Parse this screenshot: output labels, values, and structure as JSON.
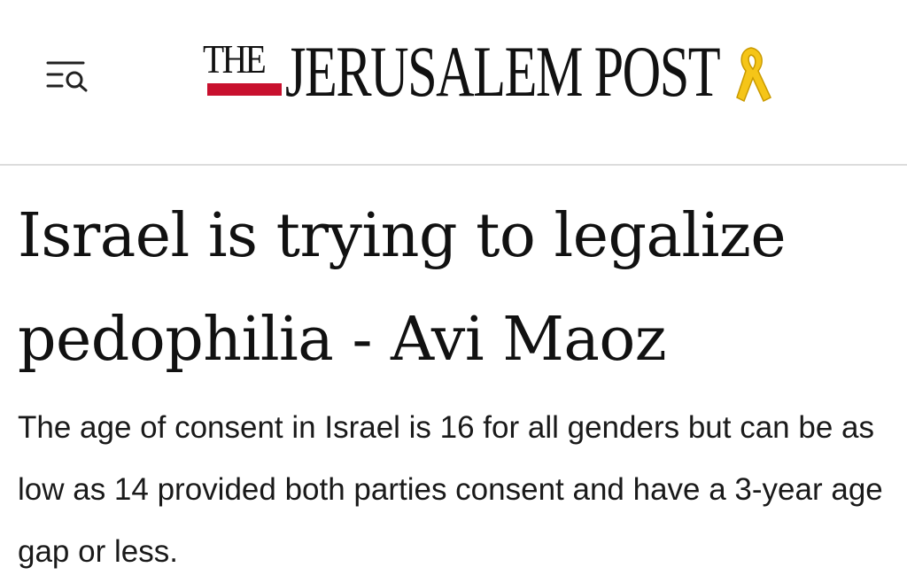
{
  "header": {
    "menu_icon": "menu-search-icon",
    "logo": {
      "small_word": "THE",
      "main_text": "JERUSALEM POST",
      "bar_color": "#c8102e",
      "ribbon_color": "#f5c518",
      "ribbon_icon": "yellow-ribbon-icon"
    }
  },
  "article": {
    "headline": "Israel is trying to legalize pedophilia - Avi Maoz",
    "subtitle": "The age of consent in Israel is 16 for all genders but can be as low as 14 provided both parties consent and have a 3-year age gap or less."
  }
}
